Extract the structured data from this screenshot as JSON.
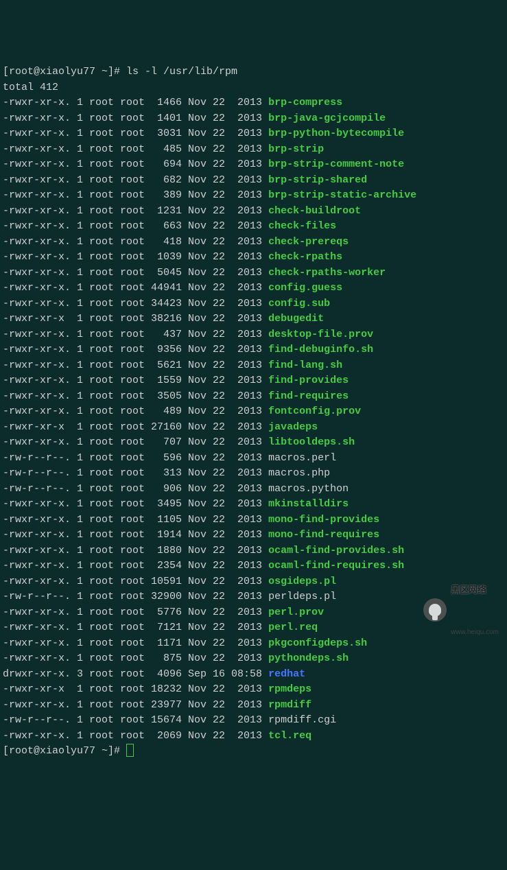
{
  "prompt_user": "root@xiaolyu77",
  "prompt_path": "~",
  "command": "ls -l /usr/lib/rpm",
  "total_line": "total 412",
  "files": [
    {
      "perm": "-rwxr-xr-x.",
      "links": "1",
      "owner": "root",
      "group": "root",
      "size": "1466",
      "date": "Nov 22  2013",
      "name": "brp-compress",
      "type": "exec"
    },
    {
      "perm": "-rwxr-xr-x.",
      "links": "1",
      "owner": "root",
      "group": "root",
      "size": "1401",
      "date": "Nov 22  2013",
      "name": "brp-java-gcjcompile",
      "type": "exec"
    },
    {
      "perm": "-rwxr-xr-x.",
      "links": "1",
      "owner": "root",
      "group": "root",
      "size": "3031",
      "date": "Nov 22  2013",
      "name": "brp-python-bytecompile",
      "type": "exec"
    },
    {
      "perm": "-rwxr-xr-x.",
      "links": "1",
      "owner": "root",
      "group": "root",
      "size": "485",
      "date": "Nov 22  2013",
      "name": "brp-strip",
      "type": "exec"
    },
    {
      "perm": "-rwxr-xr-x.",
      "links": "1",
      "owner": "root",
      "group": "root",
      "size": "694",
      "date": "Nov 22  2013",
      "name": "brp-strip-comment-note",
      "type": "exec"
    },
    {
      "perm": "-rwxr-xr-x.",
      "links": "1",
      "owner": "root",
      "group": "root",
      "size": "682",
      "date": "Nov 22  2013",
      "name": "brp-strip-shared",
      "type": "exec"
    },
    {
      "perm": "-rwxr-xr-x.",
      "links": "1",
      "owner": "root",
      "group": "root",
      "size": "389",
      "date": "Nov 22  2013",
      "name": "brp-strip-static-archive",
      "type": "exec"
    },
    {
      "perm": "-rwxr-xr-x.",
      "links": "1",
      "owner": "root",
      "group": "root",
      "size": "1231",
      "date": "Nov 22  2013",
      "name": "check-buildroot",
      "type": "exec"
    },
    {
      "perm": "-rwxr-xr-x.",
      "links": "1",
      "owner": "root",
      "group": "root",
      "size": "663",
      "date": "Nov 22  2013",
      "name": "check-files",
      "type": "exec"
    },
    {
      "perm": "-rwxr-xr-x.",
      "links": "1",
      "owner": "root",
      "group": "root",
      "size": "418",
      "date": "Nov 22  2013",
      "name": "check-prereqs",
      "type": "exec"
    },
    {
      "perm": "-rwxr-xr-x.",
      "links": "1",
      "owner": "root",
      "group": "root",
      "size": "1039",
      "date": "Nov 22  2013",
      "name": "check-rpaths",
      "type": "exec"
    },
    {
      "perm": "-rwxr-xr-x.",
      "links": "1",
      "owner": "root",
      "group": "root",
      "size": "5045",
      "date": "Nov 22  2013",
      "name": "check-rpaths-worker",
      "type": "exec"
    },
    {
      "perm": "-rwxr-xr-x.",
      "links": "1",
      "owner": "root",
      "group": "root",
      "size": "44941",
      "date": "Nov 22  2013",
      "name": "config.guess",
      "type": "exec"
    },
    {
      "perm": "-rwxr-xr-x.",
      "links": "1",
      "owner": "root",
      "group": "root",
      "size": "34423",
      "date": "Nov 22  2013",
      "name": "config.sub",
      "type": "exec"
    },
    {
      "perm": "-rwxr-xr-x ",
      "links": "1",
      "owner": "root",
      "group": "root",
      "size": "38216",
      "date": "Nov 22  2013",
      "name": "debugedit",
      "type": "exec"
    },
    {
      "perm": "-rwxr-xr-x.",
      "links": "1",
      "owner": "root",
      "group": "root",
      "size": "437",
      "date": "Nov 22  2013",
      "name": "desktop-file.prov",
      "type": "exec"
    },
    {
      "perm": "-rwxr-xr-x.",
      "links": "1",
      "owner": "root",
      "group": "root",
      "size": "9356",
      "date": "Nov 22  2013",
      "name": "find-debuginfo.sh",
      "type": "exec"
    },
    {
      "perm": "-rwxr-xr-x.",
      "links": "1",
      "owner": "root",
      "group": "root",
      "size": "5621",
      "date": "Nov 22  2013",
      "name": "find-lang.sh",
      "type": "exec"
    },
    {
      "perm": "-rwxr-xr-x.",
      "links": "1",
      "owner": "root",
      "group": "root",
      "size": "1559",
      "date": "Nov 22  2013",
      "name": "find-provides",
      "type": "exec"
    },
    {
      "perm": "-rwxr-xr-x.",
      "links": "1",
      "owner": "root",
      "group": "root",
      "size": "3505",
      "date": "Nov 22  2013",
      "name": "find-requires",
      "type": "exec"
    },
    {
      "perm": "-rwxr-xr-x.",
      "links": "1",
      "owner": "root",
      "group": "root",
      "size": "489",
      "date": "Nov 22  2013",
      "name": "fontconfig.prov",
      "type": "exec"
    },
    {
      "perm": "-rwxr-xr-x ",
      "links": "1",
      "owner": "root",
      "group": "root",
      "size": "27160",
      "date": "Nov 22  2013",
      "name": "javadeps",
      "type": "exec"
    },
    {
      "perm": "-rwxr-xr-x.",
      "links": "1",
      "owner": "root",
      "group": "root",
      "size": "707",
      "date": "Nov 22  2013",
      "name": "libtooldeps.sh",
      "type": "exec"
    },
    {
      "perm": "-rw-r--r--.",
      "links": "1",
      "owner": "root",
      "group": "root",
      "size": "596",
      "date": "Nov 22  2013",
      "name": "macros.perl",
      "type": "reg"
    },
    {
      "perm": "-rw-r--r--.",
      "links": "1",
      "owner": "root",
      "group": "root",
      "size": "313",
      "date": "Nov 22  2013",
      "name": "macros.php",
      "type": "reg"
    },
    {
      "perm": "-rw-r--r--.",
      "links": "1",
      "owner": "root",
      "group": "root",
      "size": "906",
      "date": "Nov 22  2013",
      "name": "macros.python",
      "type": "reg"
    },
    {
      "perm": "-rwxr-xr-x.",
      "links": "1",
      "owner": "root",
      "group": "root",
      "size": "3495",
      "date": "Nov 22  2013",
      "name": "mkinstalldirs",
      "type": "exec"
    },
    {
      "perm": "-rwxr-xr-x.",
      "links": "1",
      "owner": "root",
      "group": "root",
      "size": "1105",
      "date": "Nov 22  2013",
      "name": "mono-find-provides",
      "type": "exec"
    },
    {
      "perm": "-rwxr-xr-x.",
      "links": "1",
      "owner": "root",
      "group": "root",
      "size": "1914",
      "date": "Nov 22  2013",
      "name": "mono-find-requires",
      "type": "exec"
    },
    {
      "perm": "-rwxr-xr-x.",
      "links": "1",
      "owner": "root",
      "group": "root",
      "size": "1880",
      "date": "Nov 22  2013",
      "name": "ocaml-find-provides.sh",
      "type": "exec"
    },
    {
      "perm": "-rwxr-xr-x.",
      "links": "1",
      "owner": "root",
      "group": "root",
      "size": "2354",
      "date": "Nov 22  2013",
      "name": "ocaml-find-requires.sh",
      "type": "exec"
    },
    {
      "perm": "-rwxr-xr-x.",
      "links": "1",
      "owner": "root",
      "group": "root",
      "size": "10591",
      "date": "Nov 22  2013",
      "name": "osgideps.pl",
      "type": "exec"
    },
    {
      "perm": "-rw-r--r--.",
      "links": "1",
      "owner": "root",
      "group": "root",
      "size": "32900",
      "date": "Nov 22  2013",
      "name": "perldeps.pl",
      "type": "reg"
    },
    {
      "perm": "-rwxr-xr-x.",
      "links": "1",
      "owner": "root",
      "group": "root",
      "size": "5776",
      "date": "Nov 22  2013",
      "name": "perl.prov",
      "type": "exec"
    },
    {
      "perm": "-rwxr-xr-x.",
      "links": "1",
      "owner": "root",
      "group": "root",
      "size": "7121",
      "date": "Nov 22  2013",
      "name": "perl.req",
      "type": "exec"
    },
    {
      "perm": "-rwxr-xr-x.",
      "links": "1",
      "owner": "root",
      "group": "root",
      "size": "1171",
      "date": "Nov 22  2013",
      "name": "pkgconfigdeps.sh",
      "type": "exec"
    },
    {
      "perm": "-rwxr-xr-x.",
      "links": "1",
      "owner": "root",
      "group": "root",
      "size": "875",
      "date": "Nov 22  2013",
      "name": "pythondeps.sh",
      "type": "exec"
    },
    {
      "perm": "drwxr-xr-x.",
      "links": "3",
      "owner": "root",
      "group": "root",
      "size": "4096",
      "date": "Sep 16 08:58",
      "name": "redhat",
      "type": "dir"
    },
    {
      "perm": "-rwxr-xr-x ",
      "links": "1",
      "owner": "root",
      "group": "root",
      "size": "18232",
      "date": "Nov 22  2013",
      "name": "rpmdeps",
      "type": "exec"
    },
    {
      "perm": "-rwxr-xr-x.",
      "links": "1",
      "owner": "root",
      "group": "root",
      "size": "23977",
      "date": "Nov 22  2013",
      "name": "rpmdiff",
      "type": "exec"
    },
    {
      "perm": "-rw-r--r--.",
      "links": "1",
      "owner": "root",
      "group": "root",
      "size": "15674",
      "date": "Nov 22  2013",
      "name": "rpmdiff.cgi",
      "type": "reg"
    },
    {
      "perm": "-rwxr-xr-x.",
      "links": "1",
      "owner": "root",
      "group": "root",
      "size": "2069",
      "date": "Nov 22  2013",
      "name": "tcl.req",
      "type": "exec"
    }
  ],
  "watermark": {
    "main": "黑区网络",
    "sub": "www.heiqu.com"
  }
}
